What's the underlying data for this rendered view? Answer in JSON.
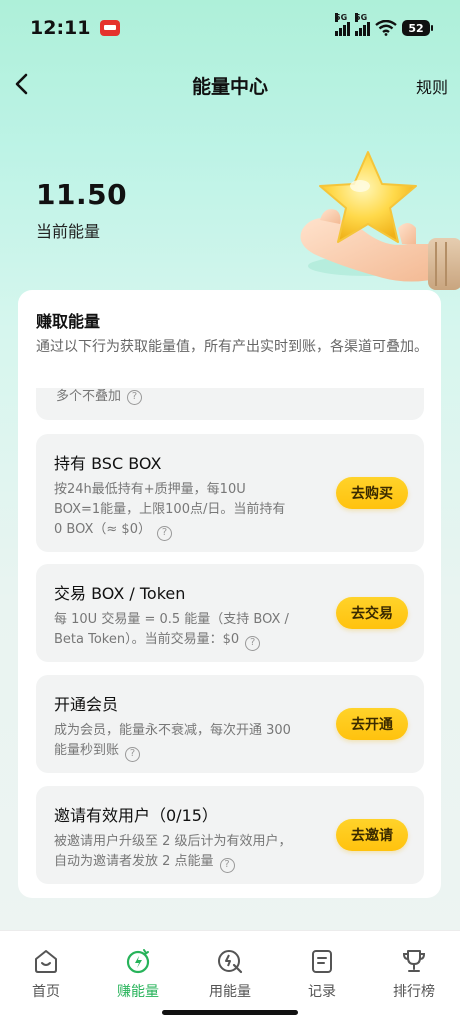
{
  "status_bar": {
    "time": "12:11",
    "network_1": "5G",
    "network_2": "5G",
    "battery": "52"
  },
  "header": {
    "title": "能量中心",
    "rules_label": "规则",
    "back_icon": "chevron-left-icon"
  },
  "energy": {
    "value": "11.50",
    "label": "当前能量"
  },
  "earn": {
    "title": "赚取能量",
    "description": "通过以下行为获取能量值，所有产出实时到账，各渠道可叠加。",
    "partial_text": "多个不叠加",
    "tasks": [
      {
        "title": "持有 BSC BOX",
        "description": "按24h最低持有+质押量，每10U BOX=1能量，上限100点/日。当前持有0 BOX（≈ $0）",
        "button": "去购买"
      },
      {
        "title": "交易 BOX / Token",
        "description": "每 10U 交易量 = 0.5 能量（支持 BOX / Beta Token）。当前交易量：$0",
        "button": "去交易"
      },
      {
        "title": "开通会员",
        "description": "成为会员，能量永不衰减，每次开通 300 能量秒到账",
        "button": "去开通"
      },
      {
        "title": "邀请有效用户（0/15）",
        "description": "被邀请用户升级至 2 级后计为有效用户，自动为邀请者发放 2 点能量",
        "button": "去邀请"
      }
    ]
  },
  "tab_bar": {
    "items": [
      {
        "label": "首页",
        "icon": "home-icon"
      },
      {
        "label": "赚能量",
        "icon": "earn-energy-icon"
      },
      {
        "label": "用能量",
        "icon": "use-energy-icon"
      },
      {
        "label": "记录",
        "icon": "record-icon"
      },
      {
        "label": "排行榜",
        "icon": "trophy-icon"
      }
    ],
    "active_index": 1
  },
  "colors": {
    "accent_green": "#27b35a",
    "button_yellow": "#ffc20e",
    "background_mint": "#aef0d9"
  }
}
